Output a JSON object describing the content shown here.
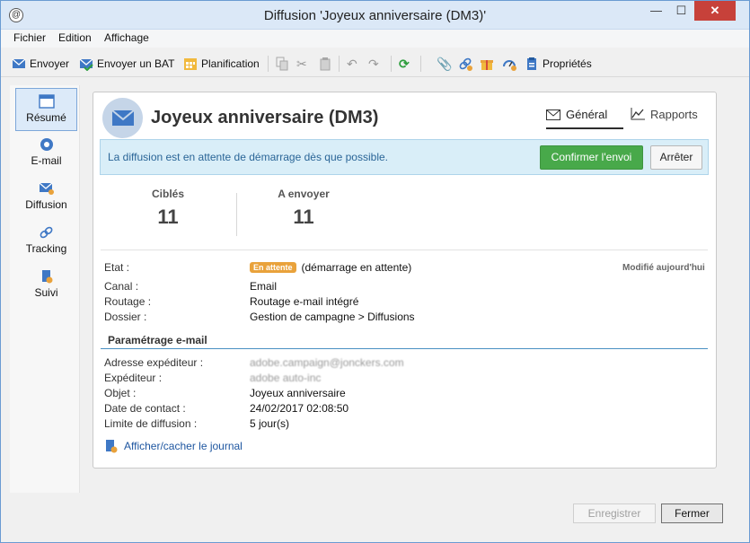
{
  "window": {
    "title": "Diffusion 'Joyeux anniversaire (DM3)'",
    "controls": {
      "minimize": "—",
      "maximize": "☐",
      "close": "✕"
    }
  },
  "menu": [
    "Fichier",
    "Edition",
    "Affichage"
  ],
  "toolbar": {
    "send": "Envoyer",
    "send_proof": "Envoyer un BAT",
    "schedule": "Planification",
    "properties": "Propriétés"
  },
  "sidebar": {
    "items": [
      {
        "label": "Résumé",
        "icon": "summary-icon",
        "active": true
      },
      {
        "label": "E-mail",
        "icon": "email-icon"
      },
      {
        "label": "Diffusion",
        "icon": "delivery-icon"
      },
      {
        "label": "Tracking",
        "icon": "tracking-icon"
      },
      {
        "label": "Suivi",
        "icon": "audit-icon"
      }
    ]
  },
  "header": {
    "title": "Joyeux anniversaire (DM3)",
    "tabs": [
      "Général",
      "Rapports"
    ]
  },
  "alert": {
    "text": "La diffusion est en attente de démarrage dès que possible.",
    "confirm_button": "Confirmer l'envoi",
    "stop_button": "Arrêter"
  },
  "stats": [
    {
      "label": "Ciblés",
      "value": "11"
    },
    {
      "label": "A envoyer",
      "value": "11"
    }
  ],
  "details": {
    "status_label": "Etat :",
    "status_badge": "En attente",
    "status_text": "(démarrage en attente)",
    "modified": "Modifié aujourd'hui",
    "channel_label": "Canal :",
    "channel": "Email",
    "routing_label": "Routage :",
    "routing": "Routage e-mail intégré",
    "folder_label": "Dossier :",
    "folder": "Gestion de campagne > Diffusions"
  },
  "email_settings": {
    "section_title": "Paramétrage e-mail",
    "sender_address_label": "Adresse expéditeur :",
    "sender_address": "adobe.campaign@jonckers.com",
    "sender_label": "Expéditeur :",
    "sender": "adobe auto-inc",
    "subject_label": "Objet :",
    "subject": "Joyeux anniversaire",
    "contact_date_label": "Date de contact :",
    "contact_date": "24/02/2017 02:08:50",
    "validity_label": "Limite de diffusion :",
    "validity": "5 jour(s)"
  },
  "journal_link": "Afficher/cacher le journal",
  "footer": {
    "save": "Enregistrer",
    "close": "Fermer"
  },
  "colors": {
    "accent": "#48a94a",
    "info_bg": "#d9eef8",
    "badge": "#e9a23b",
    "link": "#1e56a0"
  }
}
